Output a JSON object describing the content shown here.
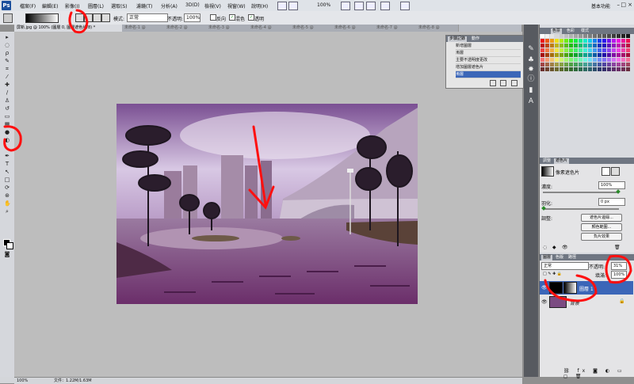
{
  "menubar": {
    "logo": "Ps",
    "items": [
      "檔案(F)",
      "編輯(E)",
      "影像(I)",
      "圖層(L)",
      "選取(S)",
      "濾鏡(T)",
      "分析(A)",
      "3D(D)",
      "檢視(V)",
      "視窗(W)",
      "說明(H)"
    ],
    "zoom": "100%",
    "workspace": "基本功能"
  },
  "options": {
    "mode_label": "模式:",
    "mode_value": "正常",
    "opacity_label": "不透明:",
    "opacity_value": "100%",
    "reverse_label": "反向",
    "dither_label": "混色",
    "transparency_label": "透明"
  },
  "tabs": [
    "屏新.jpg @ 100% (圖層 0, 圖層遮色片/8) *",
    "未命名-1 @",
    "未命名-2 @",
    "未命名-3 @",
    "未命名-4 @",
    "未命名-5 @",
    "未命名-6 @",
    "未命名-7 @",
    "未命名-8 @"
  ],
  "history": {
    "tabs": [
      "步驟記錄",
      "動作"
    ],
    "items": [
      "新增圖層",
      "漸層",
      "主要不透明度更改",
      "增加圖層遮色片",
      "漸層"
    ],
    "selected": 4
  },
  "color_panel": {
    "tabs": [
      "色票",
      "色彩",
      "樣式"
    ]
  },
  "mask_panel": {
    "tabs": [
      "調整",
      "遮色片"
    ],
    "title": "像素遮色片",
    "density_label": "濃度:",
    "density_value": "100%",
    "feather_label": "羽化:",
    "feather_value": "0 px",
    "adjust_label": "調整:",
    "btn_mask_edge": "遮色片邊緣...",
    "btn_color_range": "顏色範圍...",
    "btn_invert": "負片效果"
  },
  "layers_panel": {
    "tabs": [
      "圖層",
      "色版",
      "路徑"
    ],
    "blend": "正常",
    "opacity_label": "不透明:",
    "opacity_value": "31%",
    "fill_label": "填滿:",
    "fill_value": "100%",
    "layers": [
      "圖層 1",
      "背景"
    ]
  },
  "status": {
    "zoom": "100%",
    "doc": "文件：1.22M/1.63M"
  },
  "colors": {
    "accent": "#3b66b8",
    "annotation": "#ff1010",
    "photo_tint": "#8a4f8a"
  }
}
